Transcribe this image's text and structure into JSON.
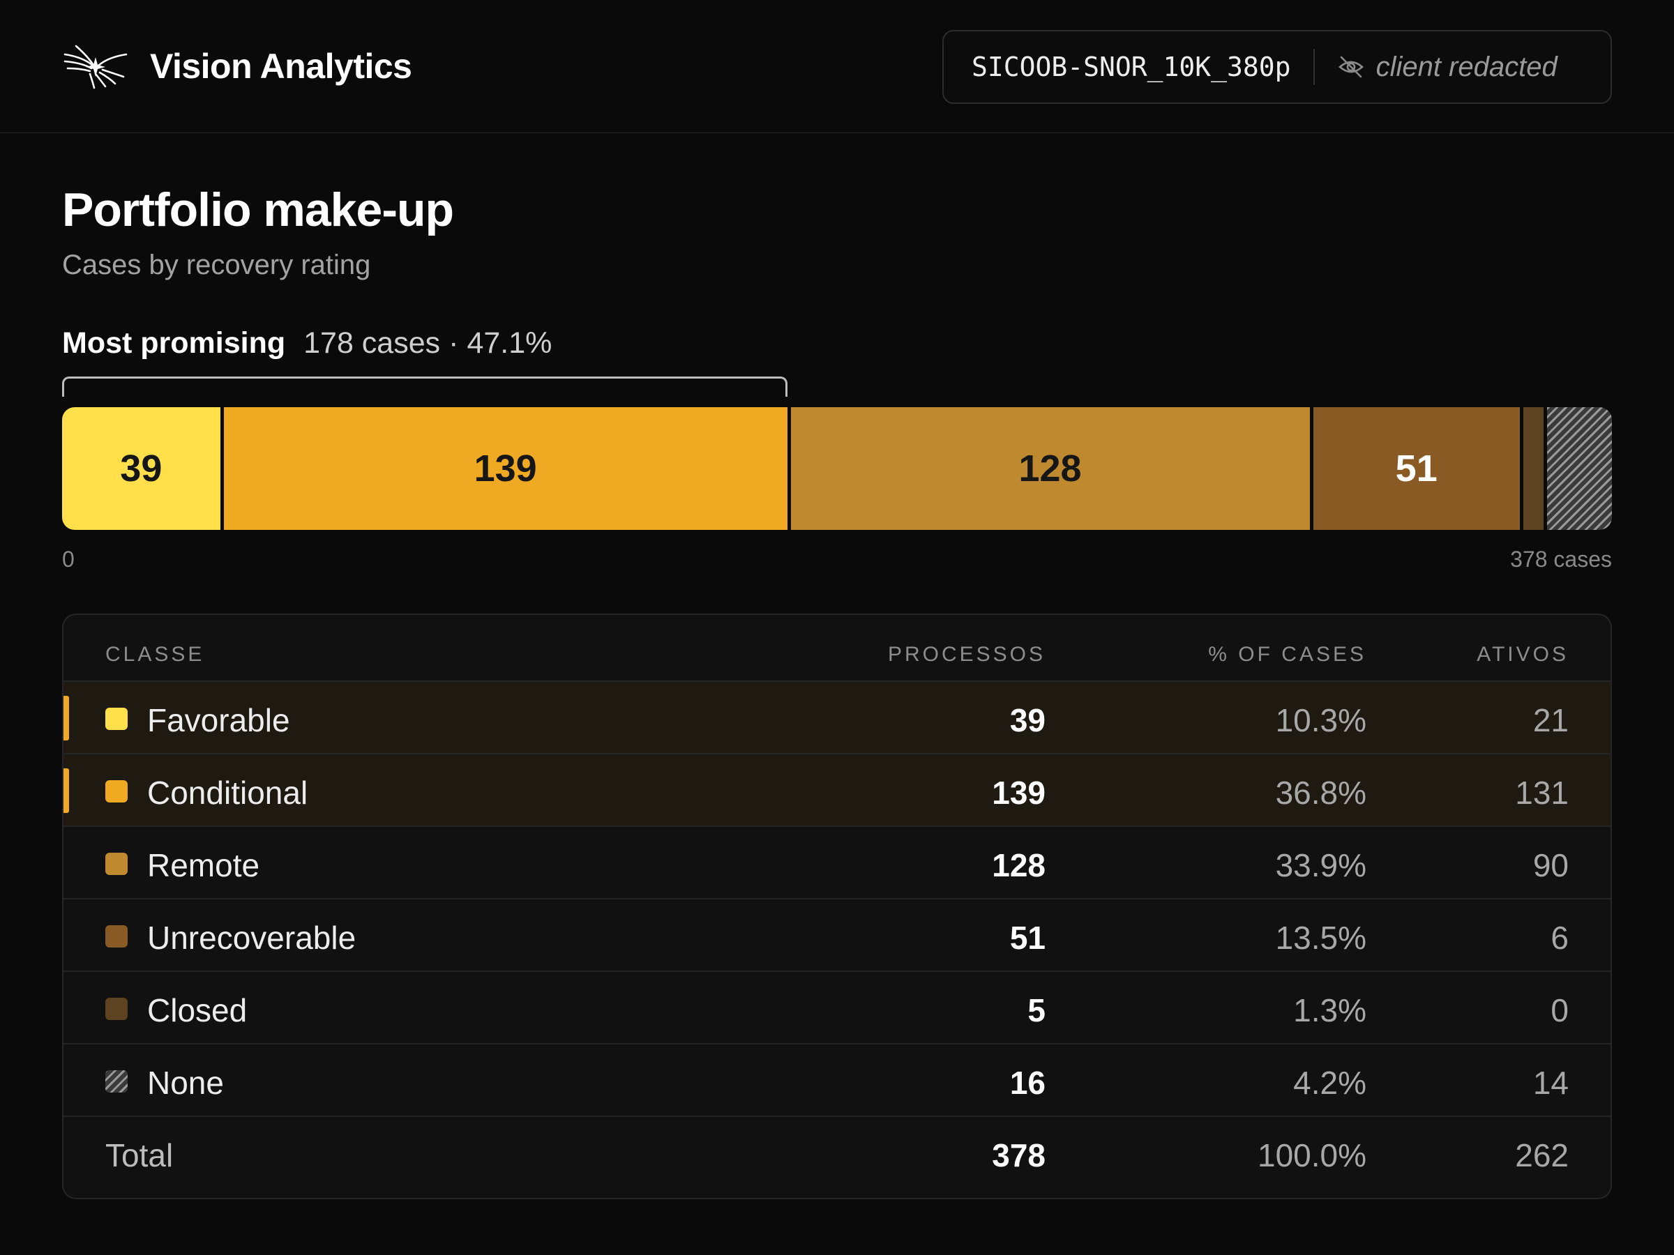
{
  "header": {
    "app_name": "Vision Analytics",
    "logo_icon": "starburst-logo",
    "dataset_id": "SICOOB-SNOR_10K_380p",
    "privacy_icon": "eye-off-icon",
    "client_label": "client redacted"
  },
  "page": {
    "title": "Portfolio make-up",
    "subtitle": "Cases by recovery rating"
  },
  "summary": {
    "label": "Most promising",
    "cases": "178 cases",
    "separator": "·",
    "percent": "47.1%"
  },
  "axis": {
    "min_label": "0",
    "max_label": "378 cases"
  },
  "chart_data": {
    "type": "bar",
    "orientation": "stacked-horizontal",
    "categories": [
      "Favorable",
      "Conditional",
      "Remote",
      "Unrecoverable",
      "Closed",
      "None"
    ],
    "values": [
      39,
      139,
      128,
      51,
      5,
      16
    ],
    "labels_shown": [
      "39",
      "139",
      "128",
      "51",
      "",
      ""
    ],
    "colors": [
      "#ffe04a",
      "#f0a922",
      "#bf8a2f",
      "#8a5a25",
      "#5e4322",
      "hatched-gray"
    ],
    "total": 378,
    "highlight": {
      "categories": [
        "Favorable",
        "Conditional"
      ],
      "cases": 178,
      "percent": 47.1
    }
  },
  "table": {
    "headers": {
      "classe": "CLASSE",
      "processos": "PROCESSOS",
      "pct": "% OF CASES",
      "ativos": "ATIVOS"
    },
    "rows": [
      {
        "classe": "Favorable",
        "processos": "39",
        "pct": "10.3%",
        "ativos": "21",
        "color": "#ffe04a",
        "highlighted": true
      },
      {
        "classe": "Conditional",
        "processos": "139",
        "pct": "36.8%",
        "ativos": "131",
        "color": "#f0a922",
        "highlighted": true
      },
      {
        "classe": "Remote",
        "processos": "128",
        "pct": "33.9%",
        "ativos": "90",
        "color": "#bf8a2f",
        "highlighted": false
      },
      {
        "classe": "Unrecoverable",
        "processos": "51",
        "pct": "13.5%",
        "ativos": "6",
        "color": "#8a5a25",
        "highlighted": false
      },
      {
        "classe": "Closed",
        "processos": "5",
        "pct": "1.3%",
        "ativos": "0",
        "color": "#5e4322",
        "highlighted": false
      },
      {
        "classe": "None",
        "processos": "16",
        "pct": "4.2%",
        "ativos": "14",
        "color": "hatched-gray",
        "highlighted": false
      }
    ],
    "total": {
      "classe": "Total",
      "processos": "378",
      "pct": "100.0%",
      "ativos": "262"
    }
  }
}
